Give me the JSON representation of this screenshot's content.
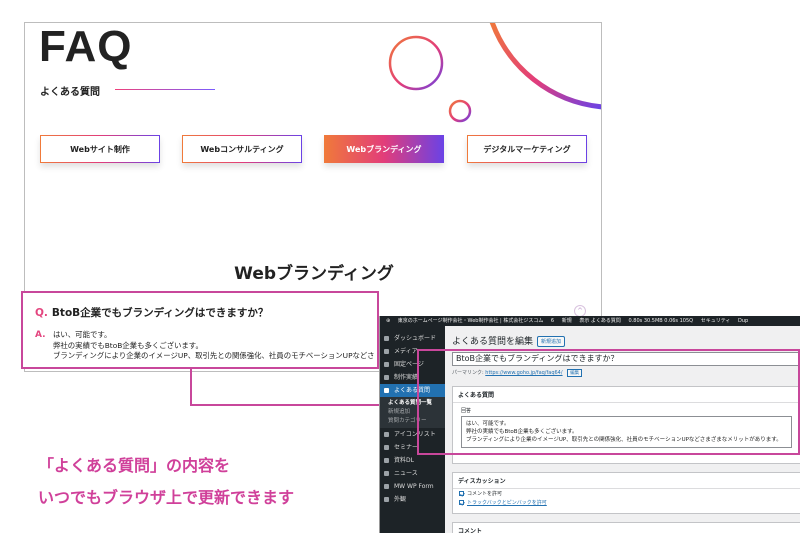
{
  "site": {
    "faq_title": "FAQ",
    "faq_subtitle": "よくある質問",
    "categories": [
      {
        "label": "Webサイト制作",
        "active": false
      },
      {
        "label": "Webコンサルティング",
        "active": false
      },
      {
        "label": "Webブランディング",
        "active": true
      },
      {
        "label": "デジタルマーケティング",
        "active": false
      }
    ],
    "section_heading": "Webブランディング",
    "qa": {
      "q_mark": "Q.",
      "question": "BtoB企業でもブランディングはできますか？",
      "a_mark": "A.",
      "answer_lines": [
        "はい、可能です。",
        "弊社の実績でもBtoB企業も多くございます。",
        "ブランディングにより企業のイメージUP、取引先との関係強化、社員のモチベーションUPなどさま"
      ]
    }
  },
  "caption": {
    "line1": "「よくある質問」の内容を",
    "line2": "いつでもブラウザ上で更新できます"
  },
  "wp_admin": {
    "adminbar": {
      "site_name": "東京のホームページ制作会社・Web制作会社 | 株式会社ジスコム",
      "count": "6",
      "new": "新規",
      "view": "表示 よくある質問",
      "stats": "0.80s 30.5MB 0.06s 105Q",
      "security": "セキュリティ",
      "dup": "Dup"
    },
    "menu": [
      {
        "label": "ダッシュボード",
        "current": false
      },
      {
        "label": "メディア",
        "current": false
      },
      {
        "label": "固定ページ",
        "current": false
      },
      {
        "label": "制作実績",
        "current": false
      },
      {
        "label": "よくある質問",
        "current": true
      }
    ],
    "submenu": [
      {
        "label": "よくある質問一覧",
        "current": true
      },
      {
        "label": "新規追加",
        "current": false
      },
      {
        "label": "質問カテゴリー",
        "current": false
      }
    ],
    "menu_lower": [
      {
        "label": "アイコンリスト"
      },
      {
        "label": "セミナー"
      },
      {
        "label": "資料DL"
      },
      {
        "label": "ニュース"
      },
      {
        "label": "MW WP Form"
      },
      {
        "label": "外観"
      }
    ],
    "page_title": "よくある質問を編集",
    "add_new": "新規追加",
    "title_value": "BtoB企業でもブランディングはできますか？",
    "permalink_label": "パーマリンク:",
    "permalink_url": "https://www.goho.jp/faq/faq64/",
    "edit_button": "編集",
    "faq_panel_title": "よくある質問",
    "answer_label": "回答",
    "answer_lines": [
      "はい、可能です。",
      "弊社の実績でもBtoB企業も多くございます。",
      "ブランディングにより企業のイメージUP、取引先との関係強化、社員のモチベーションUPなどさまざまなメリットがあります。"
    ],
    "discussion_title": "ディスカッション",
    "allow_comments": "コメントを許可",
    "allow_pings": "トラックバックとピンバックを許可",
    "comments_title": "コメント"
  },
  "colors": {
    "accent_pink": "#c8479b",
    "gradient_start": "#f07a3a",
    "gradient_end": "#6a42e6",
    "wp_dark": "#1d2327",
    "wp_blue": "#2271b1"
  }
}
